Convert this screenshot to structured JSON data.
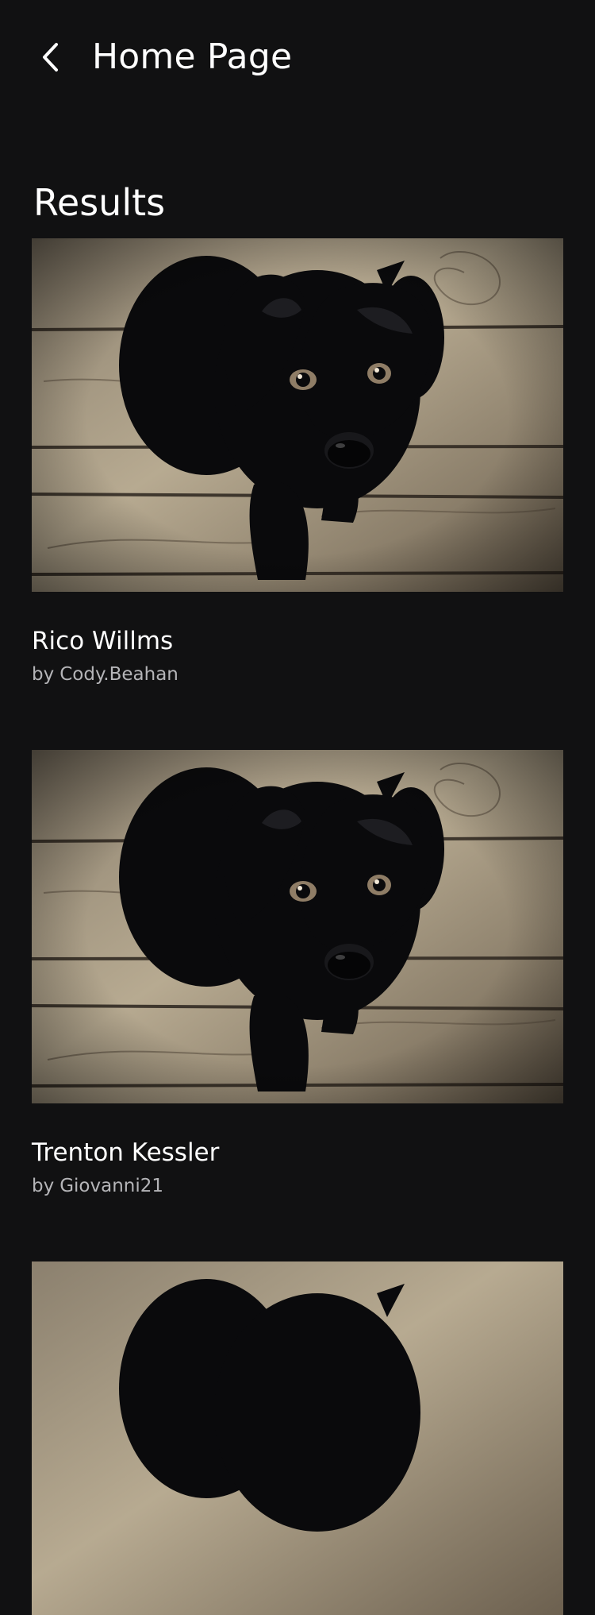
{
  "header": {
    "back_icon": "chevron-left-icon",
    "title": "Home Page"
  },
  "section": {
    "title": "Results"
  },
  "results": [
    {
      "title": "Rico Willms",
      "author_prefix": "by",
      "author": "Cody.Beahan",
      "image": "black-puppy-on-wooden-floor"
    },
    {
      "title": "Trenton Kessler",
      "author_prefix": "by",
      "author": "Giovanni21",
      "image": "black-puppy-on-wooden-floor"
    },
    {
      "title": "",
      "author_prefix": "",
      "author": "",
      "image": "black-puppy-on-wooden-floor"
    }
  ],
  "colors": {
    "background": "#111112",
    "text": "#ffffff",
    "secondary_text": "#b5b5b8",
    "wood_light": "#b7aa91",
    "wood_dark": "#4a4034",
    "dog": "#0b0b0d"
  }
}
